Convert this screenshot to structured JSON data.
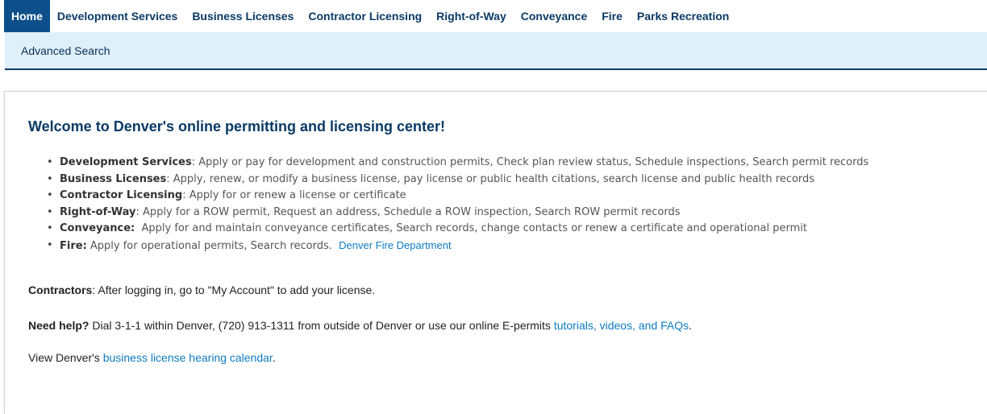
{
  "nav": {
    "tabs": [
      {
        "label": "Home",
        "active": true
      },
      {
        "label": "Development Services"
      },
      {
        "label": "Business Licenses"
      },
      {
        "label": "Contractor Licensing"
      },
      {
        "label": "Right-of-Way"
      },
      {
        "label": "Conveyance"
      },
      {
        "label": "Fire"
      },
      {
        "label": "Parks Recreation"
      }
    ],
    "sub": {
      "advanced_search": "Advanced Search"
    }
  },
  "colors": {
    "primary": "#0d4f8b",
    "nav_text": "#0b3a66",
    "subnav_bg": "#dff0fb",
    "link": "#0e7cc2"
  },
  "main": {
    "heading": "Welcome to Denver's online permitting and licensing center!",
    "services": [
      {
        "label": "Development Services",
        "text": ": Apply or pay for development and construction permits, Check plan review status, Schedule inspections, Search permit records"
      },
      {
        "label": "Business Licenses",
        "text": ": Apply, renew, or modify a business license, pay license or public health citations, search license and public health records"
      },
      {
        "label": "Contractor Licensing",
        "text": ": Apply for or renew a license or certificate"
      },
      {
        "label": "Right-of-Way",
        "text": ": Apply for a ROW permit, Request an address, Schedule a ROW inspection, Search ROW permit records"
      },
      {
        "label": "Conveyance:",
        "text": "  Apply for and maintain conveyance certificates, Search records, change contacts or renew a certificate and operational permit"
      },
      {
        "label": "Fire:",
        "text": " Apply for operational permits, Search records.  ",
        "link": "Denver Fire Department"
      }
    ],
    "contractors": {
      "bold": "Contractors",
      "text": ": After logging in, go to \"My Account\" to add your license."
    },
    "help": {
      "bold": "Need help?",
      "text": " Dial 3-1-1 within Denver, (720) 913-1311 from outside of Denver or use our online E-permits ",
      "link": "tutorials, videos, and FAQs",
      "end": "."
    },
    "calendar": {
      "text": "View Denver's ",
      "link": "business license hearing calendar",
      "end": "."
    }
  }
}
